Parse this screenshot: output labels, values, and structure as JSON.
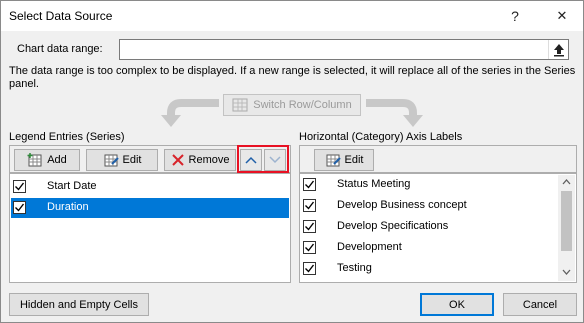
{
  "window": {
    "title": "Select Data Source",
    "help_glyph": "?",
    "close_glyph": "✕"
  },
  "range": {
    "label": "Chart data range:",
    "value": ""
  },
  "message": "The data range is too complex to be displayed. If a new range is selected, it will replace all of the series in the Series panel.",
  "switch_label": "Switch Row/Column",
  "legend": {
    "label": "Legend Entries (Series)",
    "add_label": "Add",
    "edit_label": "Edit",
    "remove_label": "Remove",
    "series": [
      {
        "label": "Start Date",
        "checked": true,
        "selected": false
      },
      {
        "label": "Duration",
        "checked": true,
        "selected": true
      }
    ]
  },
  "axis": {
    "label": "Horizontal (Category) Axis Labels",
    "edit_label": "Edit",
    "items": [
      {
        "label": "Status Meeting",
        "checked": true
      },
      {
        "label": "Develop Business concept",
        "checked": true
      },
      {
        "label": "Develop Specifications",
        "checked": true
      },
      {
        "label": "Development",
        "checked": true
      },
      {
        "label": "Testing",
        "checked": true
      }
    ]
  },
  "buttons": {
    "hidden_empty": "Hidden and Empty Cells",
    "ok": "OK",
    "cancel": "Cancel"
  },
  "colors": {
    "selection": "#0078d7",
    "highlight_border": "#e81123",
    "icon_blue": "#1f5fa8"
  }
}
